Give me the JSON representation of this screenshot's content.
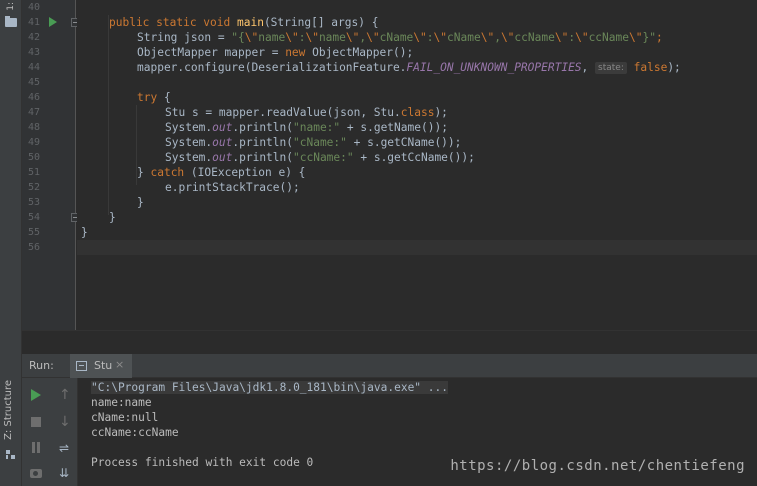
{
  "sidebar": {
    "project_tab_number": "1:",
    "structure_label": "Z: Structure"
  },
  "gutter": {
    "line_numbers": [
      "40",
      "41",
      "42",
      "43",
      "44",
      "45",
      "46",
      "47",
      "48",
      "49",
      "50",
      "51",
      "52",
      "53",
      "54",
      "55",
      "56"
    ]
  },
  "code": {
    "l41": {
      "kw": "public static void ",
      "fn": "main",
      "rest": "(String[] args) {"
    },
    "l42": {
      "pre": "String json = ",
      "str1": "\"{",
      "e1": "\\\"",
      "s1": "name",
      "e2": "\\\"",
      "s2": ":",
      "e3": "\\\"",
      "s3": "name",
      "e4": "\\\"",
      "s4": ",",
      "e5": "\\\"",
      "s5": "cName",
      "e6": "\\\"",
      "s6": ":",
      "e7": "\\\"",
      "s7": "cName",
      "e8": "\\\"",
      "s8": ",",
      "e9": "\\\"",
      "s9": "ccName",
      "e10": "\\\"",
      "s10": ":",
      "e11": "\\\"",
      "s11": "ccName",
      "e12": "\\\"",
      "s12": "}\"",
      "end": ";"
    },
    "l43": {
      "pre": "ObjectMapper mapper = ",
      "kw": "new",
      "rest": " ObjectMapper();"
    },
    "l44": {
      "pre": "mapper.configure(DeserializationFeature.",
      "fld": "FAIL_ON_UNKNOWN_PROPERTIES",
      "comma": ", ",
      "hint": "state:",
      "kw": "false",
      "end": ");"
    },
    "l46": {
      "kw": "try",
      "rest": " {"
    },
    "l47": {
      "pre": "Stu s = mapper.readValue(json, Stu.",
      "kw": "class",
      "end": ");"
    },
    "l48": {
      "pre": "System.",
      "fld": "out",
      "mid": ".println(",
      "str": "\"name:\"",
      "end": " + s.getName());"
    },
    "l49": {
      "pre": "System.",
      "fld": "out",
      "mid": ".println(",
      "str": "\"cName:\"",
      "end": " + s.getCName());"
    },
    "l50": {
      "pre": "System.",
      "fld": "out",
      "mid": ".println(",
      "str": "\"ccName:\"",
      "end": " + s.getCcName());"
    },
    "l51": {
      "pre": "} ",
      "kw": "catch",
      "rest": " (IOException e) {"
    },
    "l52": {
      "text": "e.printStackTrace();"
    },
    "l53": {
      "text": "}"
    },
    "l54": {
      "text": "}"
    },
    "l55": {
      "text": "}"
    }
  },
  "run_panel": {
    "label": "Run:",
    "tab_label": "Stu",
    "tab_close": "×"
  },
  "console": {
    "lines": [
      "\"C:\\Program Files\\Java\\jdk1.8.0_181\\bin\\java.exe\" ...",
      "name:name",
      "cName:null",
      "ccName:ccName",
      "",
      "Process finished with exit code 0"
    ]
  },
  "watermark": "https://blog.csdn.net/chentiefeng",
  "colors": {
    "keyword": "#cc7832",
    "method": "#ffc66d",
    "string": "#6a8759",
    "field": "#9876aa",
    "text": "#a9b7c6",
    "background": "#2b2b2b",
    "run_green": "#499c54"
  },
  "icons": {
    "run_gutter": "run-arrow-icon",
    "rerun": "play-icon",
    "stop": "stop-icon",
    "pause": "pause-icon",
    "snapshot": "camera-icon",
    "up": "arrow-up-icon",
    "down": "arrow-down-icon",
    "soft_wrap": "soft-wrap-icon",
    "scroll_end": "scroll-to-end-icon"
  }
}
